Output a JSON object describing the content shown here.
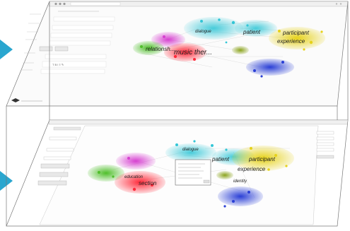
{
  "top_panel": {
    "labels": {
      "participant": "participant",
      "patient": "patient",
      "experience": "experience",
      "music_therapy": "music ther...",
      "relationship": "relationsh...",
      "dialogue": "dialogue"
    }
  },
  "bottom_panel": {
    "labels": {
      "participant": "participant",
      "patient": "patient",
      "experience": "experience",
      "dialogue": "dialogue",
      "section": "section",
      "education": "education",
      "identity": "identity"
    }
  },
  "colors": {
    "arrow": "#2aa6cf",
    "red_cluster": "#e8303a",
    "magenta_cluster": "#d640d0",
    "green_cluster": "#4fbf2a",
    "cyan_cluster": "#33c6d6",
    "yellow_cluster": "#e6d21a",
    "blue_cluster": "#2a3fd6",
    "olive_cluster": "#8aa31c"
  },
  "icons": {
    "left_arrows": "triangle-right-icon"
  }
}
